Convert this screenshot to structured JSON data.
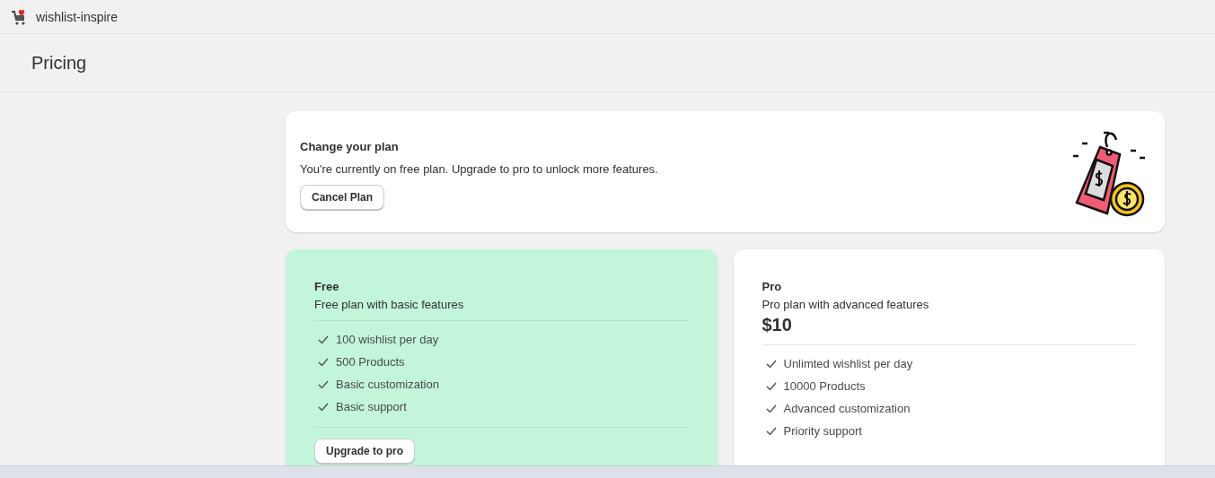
{
  "app": {
    "title": "wishlist-inspire"
  },
  "page": {
    "title": "Pricing"
  },
  "plan_banner": {
    "title": "Change your plan",
    "text": "You're currently on free plan. Upgrade to pro to unlock more features.",
    "button": "Cancel Plan"
  },
  "plans": [
    {
      "name": "Free",
      "description": "Free plan with basic features",
      "selected": true,
      "features": [
        "100 wishlist per day",
        "500 Products",
        "Basic customization",
        "Basic support"
      ],
      "button": "Upgrade to pro"
    },
    {
      "name": "Pro",
      "description": "Pro plan with advanced features",
      "price": "$10",
      "selected": false,
      "features": [
        "Unlimted wishlist per day",
        "10000 Products",
        "Advanced customization",
        "Priority support"
      ]
    }
  ]
}
